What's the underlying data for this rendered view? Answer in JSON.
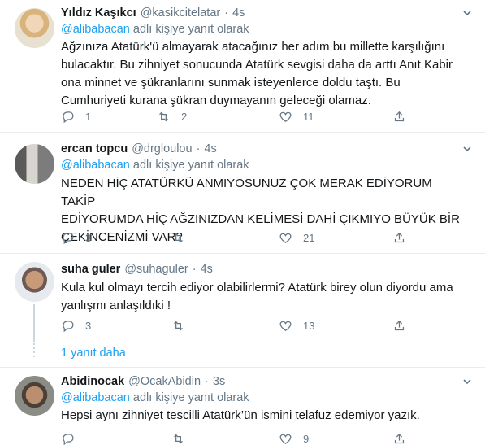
{
  "tweets": [
    {
      "name": "Yıldız Kaşıkcı",
      "handle": "@kasikcitelatar",
      "dot": "·",
      "time": "4s",
      "reply_mention": "@alibabacan",
      "reply_suffix": "adlı kişiye yanıt olarak",
      "lines": [
        "Ağzınıza Atatürk'ü almayarak atacağınız her adım bu millette karşılığını",
        "bulacaktır. Bu zihniyet sonucunda Atatürk sevgisi daha da arttı Anıt Kabir",
        "ona minnet ve şükranlarını sunmak isteyenlerce doldu taştı. Bu",
        "Cumhuriyeti kurana şükran duymayanın geleceği olamaz."
      ],
      "replies": "1",
      "retweets": "2",
      "likes": "11"
    },
    {
      "name": "ercan topcu",
      "handle": "@drgloulou",
      "dot": "·",
      "time": "4s",
      "reply_mention": "@alibabacan",
      "reply_suffix": "adlı kişiye yanıt olarak",
      "lines": [
        "NEDEN HİÇ ATATÜRKÜ ANMIYOSUNUZ ÇOK MERAK EDİYORUM TAKİP",
        "EDİYORUMDA HİÇ AĞZINIZDAN KELİMESİ DAHİ ÇIKMIYO BÜYÜK BİR",
        "ÇEKİNCENİZMİ VAR?"
      ],
      "replies": "3",
      "retweets": "",
      "likes": "21"
    },
    {
      "name": "suha guler",
      "handle": "@suhaguler",
      "dot": "·",
      "time": "4s",
      "lines": [
        "Kula kul olmayı tercih ediyor olabilirlermi? Atatürk birey olun diyordu ama",
        "yanlışmı anlaşıldıki !"
      ],
      "replies": "3",
      "retweets": "",
      "likes": "13"
    },
    {
      "name": "Abidinocak",
      "handle": "@OcakAbidin",
      "dot": "·",
      "time": "3s",
      "reply_mention": "@alibabacan",
      "reply_suffix": "adlı kişiye yanıt olarak",
      "lines": [
        "Hepsi aynı zihniyet tescilli Atatürk’ün ismini telafuz edemiyor yazık."
      ],
      "replies": "",
      "retweets": "",
      "likes": "9"
    }
  ],
  "thread": {
    "more_replies": "1 yanıt daha"
  },
  "colors": {
    "accent": "#1da1f2",
    "muted": "#657786",
    "text": "#14171a",
    "border": "#e6ecf0"
  },
  "icons": {
    "reply": "reply-icon",
    "retweet": "retweet-icon",
    "like": "heart-icon",
    "share": "share-icon",
    "caret": "chevron-down-icon"
  }
}
